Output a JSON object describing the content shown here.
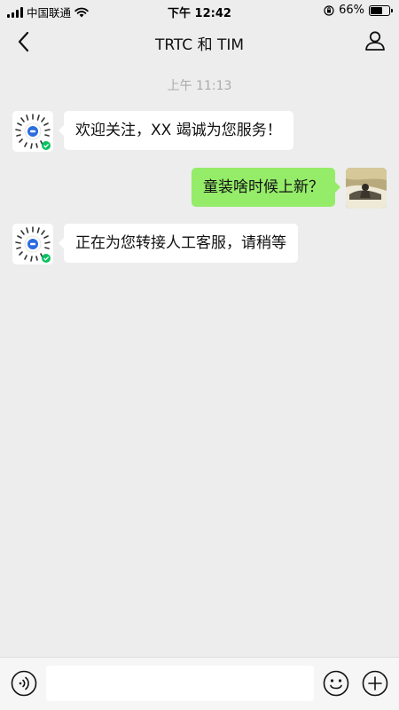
{
  "status_bar": {
    "carrier": "中国联通",
    "time": "下午 12:42",
    "battery": "66%",
    "battery_level": 0.66
  },
  "nav": {
    "title": "TRTC 和 TIM",
    "back_icon": "chevron-left-icon",
    "user_icon": "person-icon"
  },
  "chat": {
    "timestamp": "上午 11:13",
    "messages": [
      {
        "side": "left",
        "text": "欢迎关注，XX 竭诚为您服务！"
      },
      {
        "side": "right",
        "text": "童装啥时候上新？"
      },
      {
        "side": "left",
        "text": "正在为您转接人工客服，请稍等"
      }
    ]
  },
  "input_bar": {
    "placeholder": "",
    "voice_icon": "voice-icon",
    "emoji_icon": "emoji-icon",
    "plus_icon": "plus-icon"
  },
  "colors": {
    "background": "#ededed",
    "sent_bubble": "#95ec69",
    "received_bubble": "#ffffff",
    "timestamp": "#aaaaaa"
  }
}
